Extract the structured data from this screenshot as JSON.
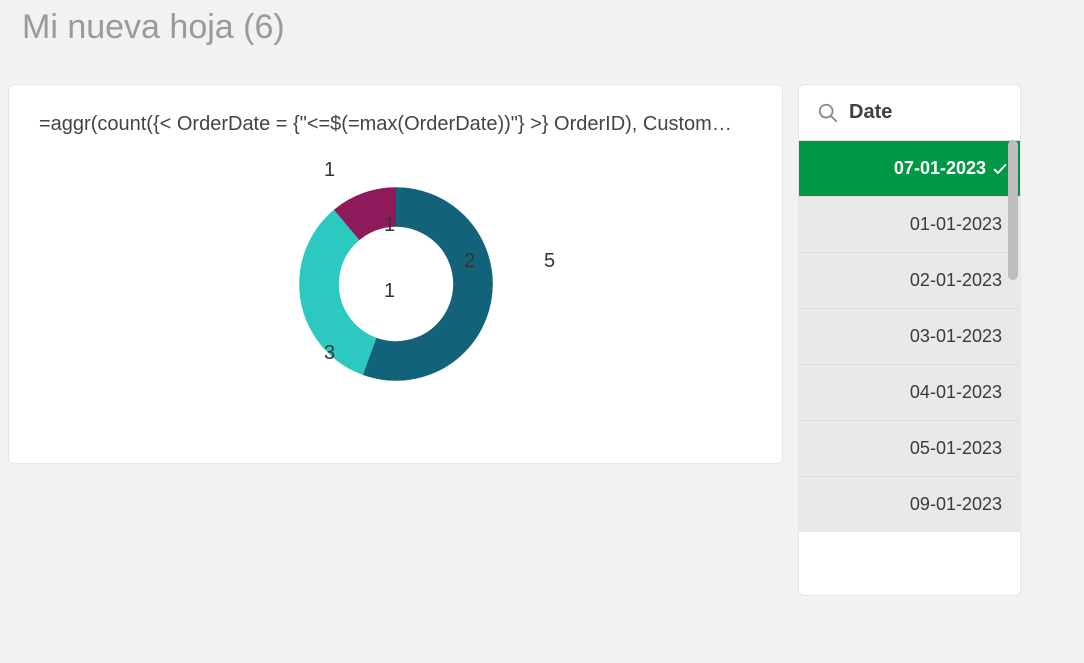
{
  "page": {
    "title": "Mi nueva hoja (6)"
  },
  "chart": {
    "formula": "=aggr(count({< OrderDate = {\"<=$(=max(OrderDate))\"} >} OrderID), Custom…",
    "outer_labels": {
      "top_left": "1",
      "bottom_left": "3",
      "right": "5"
    },
    "inner_labels": {
      "top": "1",
      "right": "2",
      "bottom": "1"
    }
  },
  "chart_data": {
    "type": "pie",
    "title": "=aggr(count({< OrderDate = {\"<=$(=max(OrderDate))\"} >} OrderID), Custom…",
    "slices": [
      {
        "label": "5",
        "inner_label": "2",
        "value": 5,
        "color": "#12637a"
      },
      {
        "label": "3",
        "inner_label": "1",
        "value": 3,
        "color": "#2cc9c1"
      },
      {
        "label": "1",
        "inner_label": "1",
        "value": 1,
        "color": "#8e1a59"
      }
    ],
    "donut": true
  },
  "filter": {
    "title": "Date",
    "selected_index": 0,
    "items": [
      {
        "label": "07-01-2023",
        "selected": true
      },
      {
        "label": "01-01-2023",
        "selected": false
      },
      {
        "label": "02-01-2023",
        "selected": false
      },
      {
        "label": "03-01-2023",
        "selected": false
      },
      {
        "label": "04-01-2023",
        "selected": false
      },
      {
        "label": "05-01-2023",
        "selected": false
      },
      {
        "label": "09-01-2023",
        "selected": false
      }
    ]
  }
}
